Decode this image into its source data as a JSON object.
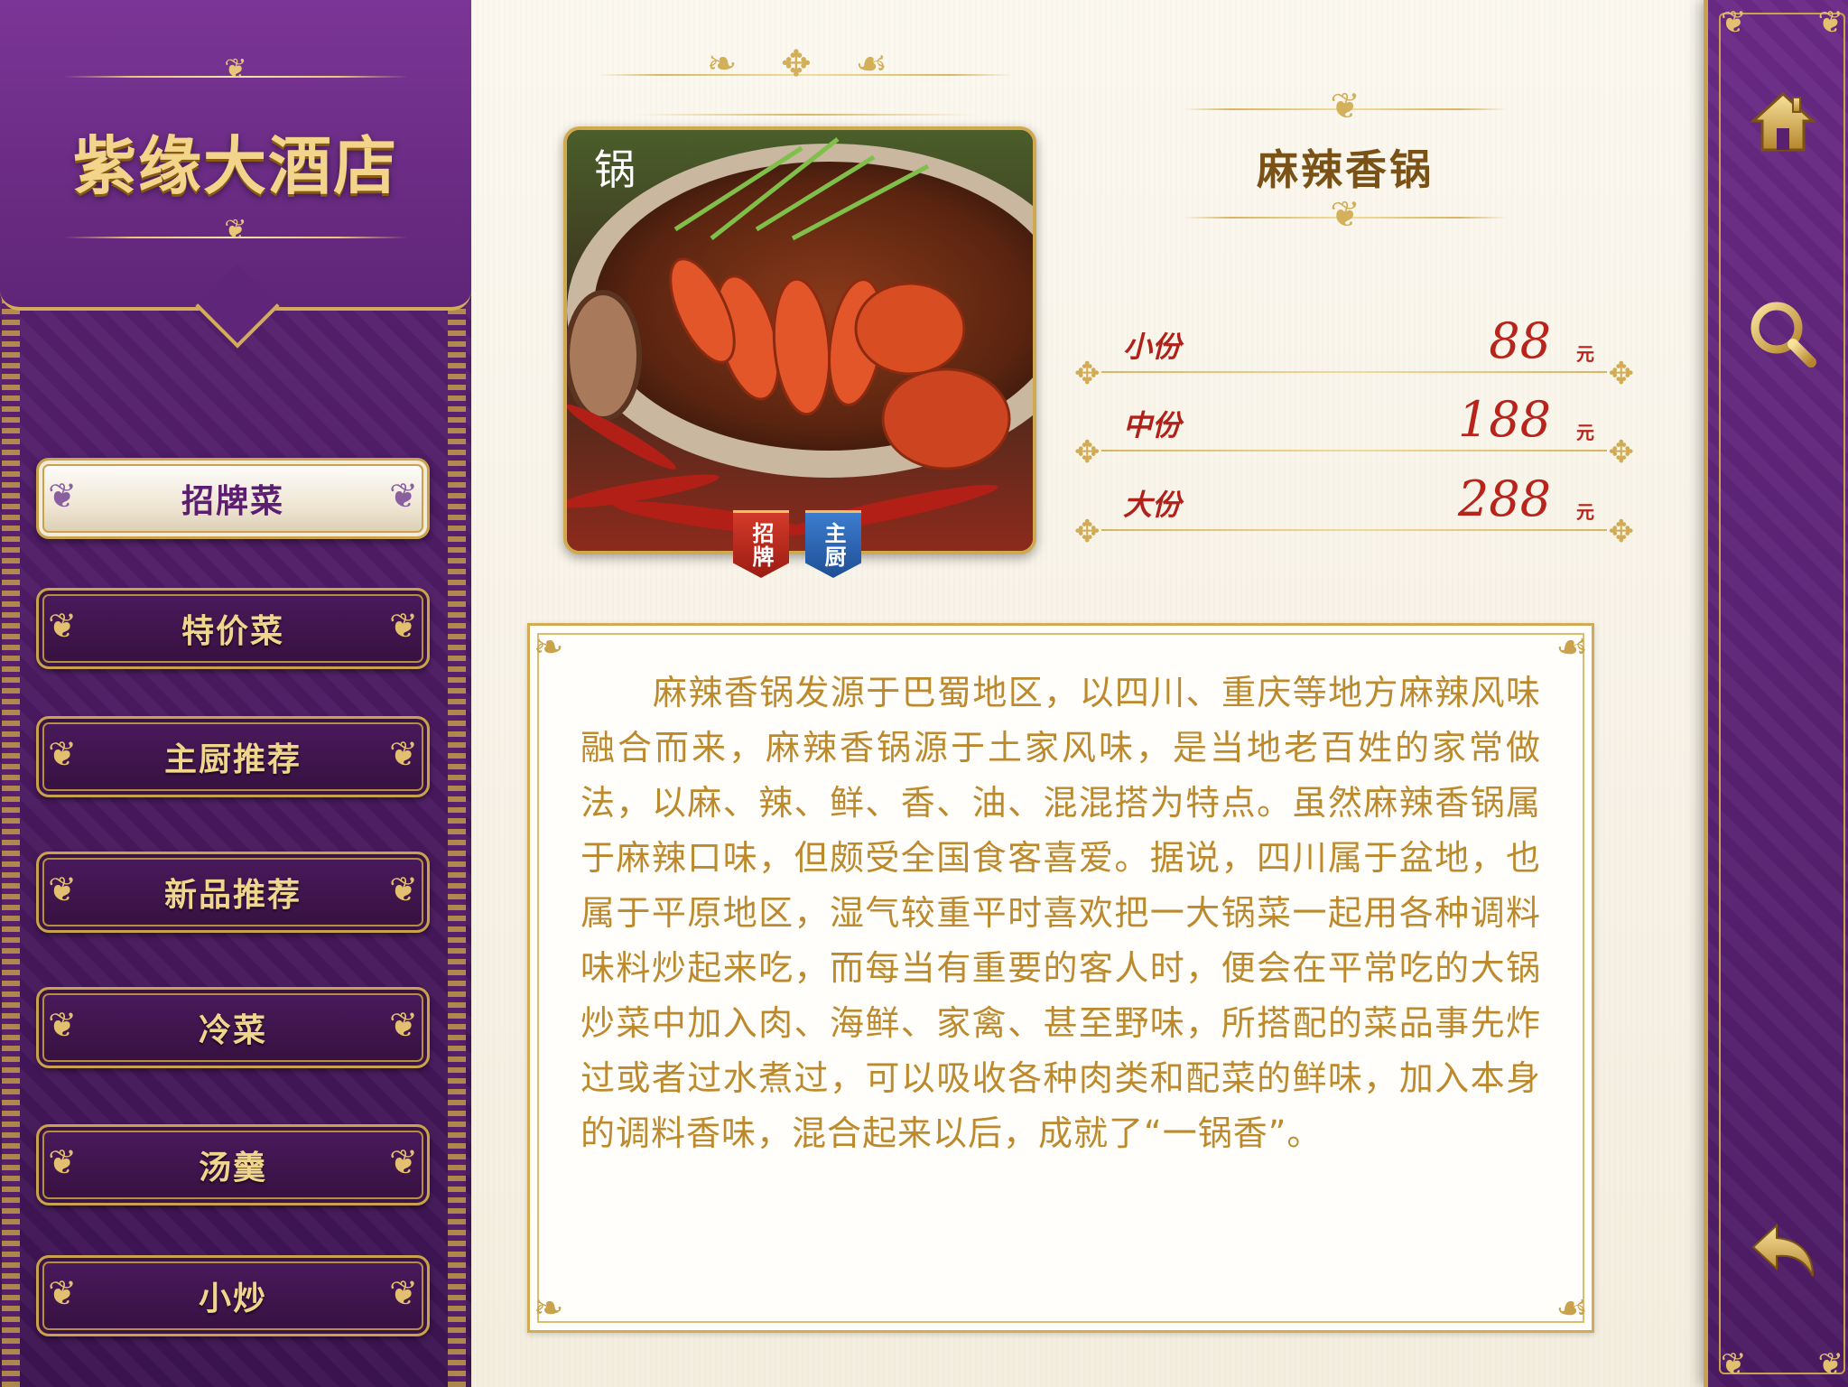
{
  "restaurant": {
    "name": "紫缘大酒店"
  },
  "nav": {
    "items": [
      {
        "label": "招牌菜",
        "active": true
      },
      {
        "label": "特价菜",
        "active": false
      },
      {
        "label": "主厨推荐",
        "active": false
      },
      {
        "label": "新品推荐",
        "active": false
      },
      {
        "label": "冷菜",
        "active": false
      },
      {
        "label": "汤羹",
        "active": false
      },
      {
        "label": "小炒",
        "active": false
      }
    ]
  },
  "toolbar": {
    "home_icon": "home-icon",
    "search_icon": "search-icon",
    "back_icon": "back-arrow-icon"
  },
  "dish": {
    "name": "麻辣香锅",
    "badges": [
      {
        "label": "招牌",
        "color": "#b8271a"
      },
      {
        "label": "主厨",
        "color": "#2a62b0"
      }
    ],
    "prices": [
      {
        "size": "小份",
        "amount": "88",
        "unit": "元"
      },
      {
        "size": "中份",
        "amount": "188",
        "unit": "元"
      },
      {
        "size": "大份",
        "amount": "288",
        "unit": "元"
      }
    ],
    "description": "麻辣香锅发源于巴蜀地区，以四川、重庆等地方麻辣风味融合而来，麻辣香锅源于土家风味，是当地老百姓的家常做法，以麻、辣、鲜、香、油、混混搭为特点。虽然麻辣香锅属于麻辣口味，但颇受全国食客喜爱。据说，四川属于盆地，也属于平原地区，湿气较重平时喜欢把一大锅菜一起用各种调料味料炒起来吃，而每当有重要的客人时，便会在平常吃的大锅炒菜中加入肉、海鲜、家禽、甚至野味，所搭配的菜品事先炸过或者过水煮过，可以吸收各种肉类和配菜的鲜味，加入本身的调料香味，混合起来以后，成就了“一锅香”。"
  },
  "colors": {
    "purple": "#5e2476",
    "gold": "#d1ac55",
    "price_red": "#b8231b",
    "text_gold": "#bc8a2c"
  }
}
